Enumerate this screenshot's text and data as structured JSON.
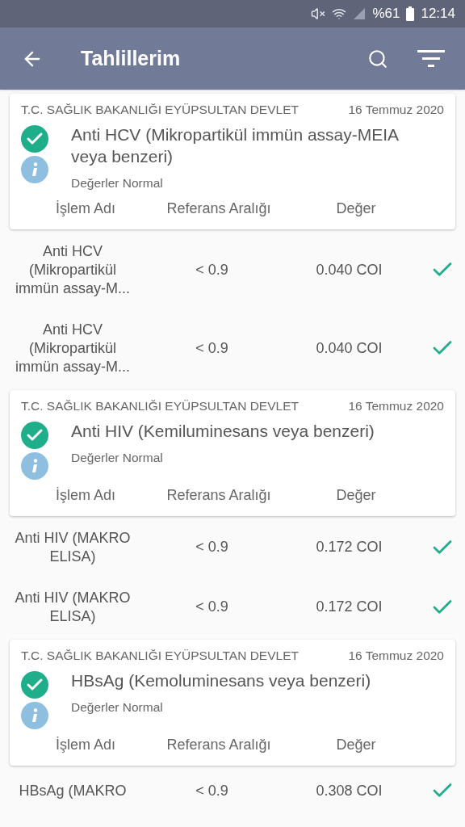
{
  "status_bar": {
    "battery": "%61",
    "time": "12:14"
  },
  "app_bar": {
    "title": "Tahlillerim"
  },
  "results": [
    {
      "hospital": "T.C. SAĞLIK BAKANLIĞI EYÜPSULTAN DEVLET",
      "date": "16 Temmuz 2020",
      "title": "Anti HCV (Mikropartikül immün assay-MEIA veya benzeri)",
      "normal": true,
      "status": "Değerler Normal",
      "columns": [
        "İşlem Adı",
        "Referans Aralığı",
        "Değer"
      ],
      "rows": [
        {
          "name": "Anti HCV (Mikropartikül immün assay-M...",
          "reference": "< 0.9",
          "value": "0.040 COI",
          "checked": true
        },
        {
          "name": "Anti HCV (Mikropartikül immün assay-M...",
          "reference": "< 0.9",
          "value": "0.040 COI",
          "checked": true
        }
      ]
    },
    {
      "hospital": "T.C. SAĞLIK BAKANLIĞI EYÜPSULTAN DEVLET",
      "date": "16 Temmuz 2020",
      "title": "Anti HIV (Kemiluminesans veya benzeri)",
      "normal": true,
      "status": "Değerler Normal",
      "columns": [
        "İşlem Adı",
        "Referans Aralığı",
        "Değer"
      ],
      "rows": [
        {
          "name": "Anti HIV (MAKRO ELISA)",
          "reference": "< 0.9",
          "value": "0.172 COI",
          "checked": true
        },
        {
          "name": "Anti HIV (MAKRO ELISA)",
          "reference": "< 0.9",
          "value": "0.172 COI",
          "checked": true
        }
      ]
    },
    {
      "hospital": "T.C. SAĞLIK BAKANLIĞI EYÜPSULTAN DEVLET",
      "date": "16 Temmuz 2020",
      "title": "HBsAg (Kemoluminesans veya benzeri)",
      "normal": true,
      "status": "Değerler Normal",
      "columns": [
        "İşlem Adı",
        "Referans Aralığı",
        "Değer"
      ],
      "rows": [
        {
          "name": "HBsAg (MAKRO",
          "reference": "< 0.9",
          "value": "0.308 COI",
          "checked": true
        }
      ]
    }
  ]
}
